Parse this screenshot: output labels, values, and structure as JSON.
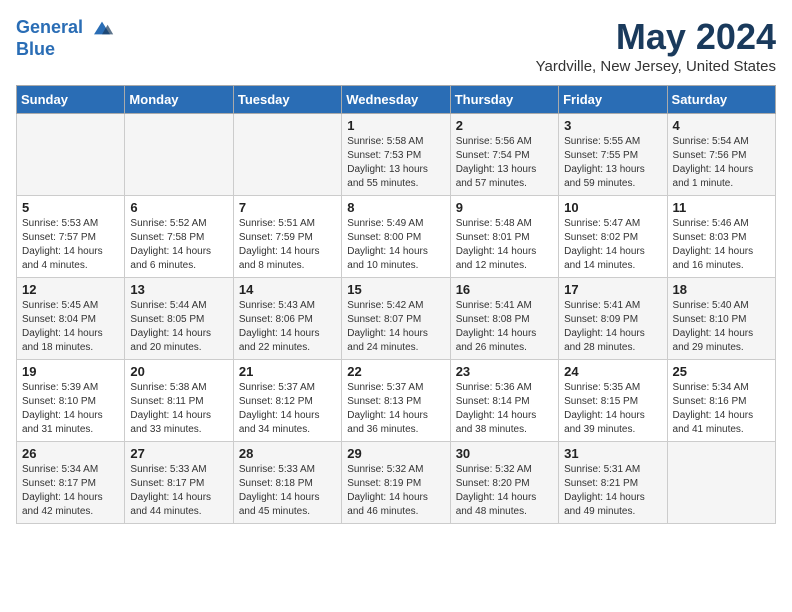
{
  "header": {
    "logo_line1": "General",
    "logo_line2": "Blue",
    "month": "May 2024",
    "location": "Yardville, New Jersey, United States"
  },
  "weekdays": [
    "Sunday",
    "Monday",
    "Tuesday",
    "Wednesday",
    "Thursday",
    "Friday",
    "Saturday"
  ],
  "weeks": [
    [
      {
        "day": "",
        "text": ""
      },
      {
        "day": "",
        "text": ""
      },
      {
        "day": "",
        "text": ""
      },
      {
        "day": "1",
        "text": "Sunrise: 5:58 AM\nSunset: 7:53 PM\nDaylight: 13 hours\nand 55 minutes."
      },
      {
        "day": "2",
        "text": "Sunrise: 5:56 AM\nSunset: 7:54 PM\nDaylight: 13 hours\nand 57 minutes."
      },
      {
        "day": "3",
        "text": "Sunrise: 5:55 AM\nSunset: 7:55 PM\nDaylight: 13 hours\nand 59 minutes."
      },
      {
        "day": "4",
        "text": "Sunrise: 5:54 AM\nSunset: 7:56 PM\nDaylight: 14 hours\nand 1 minute."
      }
    ],
    [
      {
        "day": "5",
        "text": "Sunrise: 5:53 AM\nSunset: 7:57 PM\nDaylight: 14 hours\nand 4 minutes."
      },
      {
        "day": "6",
        "text": "Sunrise: 5:52 AM\nSunset: 7:58 PM\nDaylight: 14 hours\nand 6 minutes."
      },
      {
        "day": "7",
        "text": "Sunrise: 5:51 AM\nSunset: 7:59 PM\nDaylight: 14 hours\nand 8 minutes."
      },
      {
        "day": "8",
        "text": "Sunrise: 5:49 AM\nSunset: 8:00 PM\nDaylight: 14 hours\nand 10 minutes."
      },
      {
        "day": "9",
        "text": "Sunrise: 5:48 AM\nSunset: 8:01 PM\nDaylight: 14 hours\nand 12 minutes."
      },
      {
        "day": "10",
        "text": "Sunrise: 5:47 AM\nSunset: 8:02 PM\nDaylight: 14 hours\nand 14 minutes."
      },
      {
        "day": "11",
        "text": "Sunrise: 5:46 AM\nSunset: 8:03 PM\nDaylight: 14 hours\nand 16 minutes."
      }
    ],
    [
      {
        "day": "12",
        "text": "Sunrise: 5:45 AM\nSunset: 8:04 PM\nDaylight: 14 hours\nand 18 minutes."
      },
      {
        "day": "13",
        "text": "Sunrise: 5:44 AM\nSunset: 8:05 PM\nDaylight: 14 hours\nand 20 minutes."
      },
      {
        "day": "14",
        "text": "Sunrise: 5:43 AM\nSunset: 8:06 PM\nDaylight: 14 hours\nand 22 minutes."
      },
      {
        "day": "15",
        "text": "Sunrise: 5:42 AM\nSunset: 8:07 PM\nDaylight: 14 hours\nand 24 minutes."
      },
      {
        "day": "16",
        "text": "Sunrise: 5:41 AM\nSunset: 8:08 PM\nDaylight: 14 hours\nand 26 minutes."
      },
      {
        "day": "17",
        "text": "Sunrise: 5:41 AM\nSunset: 8:09 PM\nDaylight: 14 hours\nand 28 minutes."
      },
      {
        "day": "18",
        "text": "Sunrise: 5:40 AM\nSunset: 8:10 PM\nDaylight: 14 hours\nand 29 minutes."
      }
    ],
    [
      {
        "day": "19",
        "text": "Sunrise: 5:39 AM\nSunset: 8:10 PM\nDaylight: 14 hours\nand 31 minutes."
      },
      {
        "day": "20",
        "text": "Sunrise: 5:38 AM\nSunset: 8:11 PM\nDaylight: 14 hours\nand 33 minutes."
      },
      {
        "day": "21",
        "text": "Sunrise: 5:37 AM\nSunset: 8:12 PM\nDaylight: 14 hours\nand 34 minutes."
      },
      {
        "day": "22",
        "text": "Sunrise: 5:37 AM\nSunset: 8:13 PM\nDaylight: 14 hours\nand 36 minutes."
      },
      {
        "day": "23",
        "text": "Sunrise: 5:36 AM\nSunset: 8:14 PM\nDaylight: 14 hours\nand 38 minutes."
      },
      {
        "day": "24",
        "text": "Sunrise: 5:35 AM\nSunset: 8:15 PM\nDaylight: 14 hours\nand 39 minutes."
      },
      {
        "day": "25",
        "text": "Sunrise: 5:34 AM\nSunset: 8:16 PM\nDaylight: 14 hours\nand 41 minutes."
      }
    ],
    [
      {
        "day": "26",
        "text": "Sunrise: 5:34 AM\nSunset: 8:17 PM\nDaylight: 14 hours\nand 42 minutes."
      },
      {
        "day": "27",
        "text": "Sunrise: 5:33 AM\nSunset: 8:17 PM\nDaylight: 14 hours\nand 44 minutes."
      },
      {
        "day": "28",
        "text": "Sunrise: 5:33 AM\nSunset: 8:18 PM\nDaylight: 14 hours\nand 45 minutes."
      },
      {
        "day": "29",
        "text": "Sunrise: 5:32 AM\nSunset: 8:19 PM\nDaylight: 14 hours\nand 46 minutes."
      },
      {
        "day": "30",
        "text": "Sunrise: 5:32 AM\nSunset: 8:20 PM\nDaylight: 14 hours\nand 48 minutes."
      },
      {
        "day": "31",
        "text": "Sunrise: 5:31 AM\nSunset: 8:21 PM\nDaylight: 14 hours\nand 49 minutes."
      },
      {
        "day": "",
        "text": ""
      }
    ]
  ]
}
